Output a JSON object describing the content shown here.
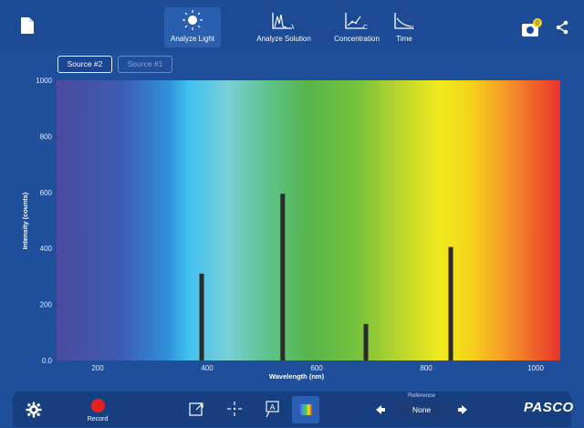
{
  "header": {
    "tabs": [
      {
        "label": "Analyze Light",
        "icon": "light-bulb-icon",
        "active": true
      },
      {
        "label": "Analyze Solution",
        "icon": "solution-spectrum-icon"
      },
      {
        "label": "Concentration",
        "icon": "concentration-graph-icon"
      },
      {
        "label": "Time",
        "icon": "time-graph-icon"
      }
    ],
    "badge_count": "0"
  },
  "sources": {
    "source2_label": "Source #2",
    "source1_label": "Source #1"
  },
  "chart_data": {
    "type": "bar",
    "xlabel": "Wavelength (nm)",
    "ylabel": "Intensity (counts)",
    "xlim": [
      125,
      1045
    ],
    "ylim": [
      0,
      1000
    ],
    "x_ticks": [
      "200",
      "400",
      "600",
      "800",
      "1000"
    ],
    "y_ticks": [
      "0.0",
      "200",
      "400",
      "600",
      "800",
      "1000"
    ],
    "x": [
      390,
      538,
      690,
      845
    ],
    "values": [
      310,
      595,
      130,
      405
    ],
    "bar_color": "#2b2b2b",
    "spectrum_gradient": "violet-blue-cyan-green-yellow-orange-red",
    "grid": false
  },
  "footer": {
    "record_label": "Record",
    "reference_label": "Reference",
    "reference_value": "None",
    "logo_text": "PASCO"
  },
  "colors": {
    "background": "#1f4e9a",
    "record": "#e62020"
  }
}
